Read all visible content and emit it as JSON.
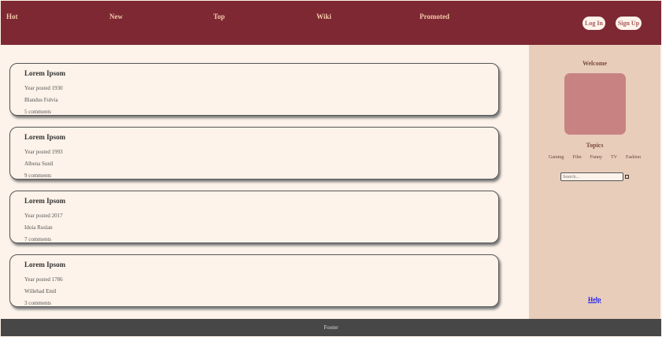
{
  "nav": {
    "items": [
      "Hot",
      "New",
      "Top",
      "Wiki",
      "Promoted"
    ],
    "login": "Log In",
    "signup": "Sign Up"
  },
  "posts": [
    {
      "title": "Lorem Ipsom",
      "year": "Year posted 1930",
      "author": "Blandus Fulvia",
      "comments": "5 comments"
    },
    {
      "title": "Lorem Ipsom",
      "year": "Year posted 1993",
      "author": "Albena Sunil",
      "comments": "9 comments"
    },
    {
      "title": "Lorem Ipsom",
      "year": "Year posted 2017",
      "author": "Idoia Ruslan",
      "comments": "7 comments"
    },
    {
      "title": "Lorem Ipsom",
      "year": "Year posted 1786",
      "author": "Willehad Emil",
      "comments": "3 comments"
    }
  ],
  "sidebar": {
    "welcome": "Welcome",
    "topics_title": "Topics",
    "topics": [
      "Gaming",
      "Film",
      "Funny",
      "TV",
      "Fashion"
    ],
    "search_placeholder": "Search...",
    "help": "Help"
  },
  "footer": "Footer",
  "colors": {
    "nav": "#7e2833",
    "sidebar": "#e8cdbb",
    "background": "#fdf3ea",
    "footer": "#474747",
    "avatar": "#c88282"
  }
}
